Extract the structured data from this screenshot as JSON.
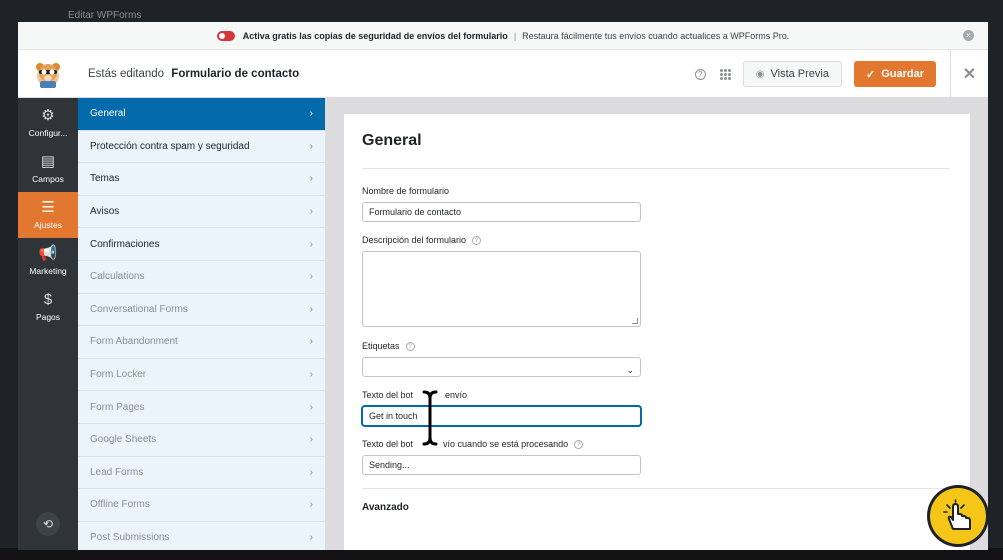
{
  "backdrop": {
    "title": "Editar WPForms"
  },
  "notice": {
    "strong_text": "Activa gratis las copias de seguridad de envíos del formulario",
    "separator": "|",
    "text": "Restaura fácilmente tus envíos cuando actualices a WPForms Pro.",
    "dismiss": "×"
  },
  "header": {
    "editing_label": "Estás editando",
    "form_name": "Formulario de contacto",
    "help": "?",
    "preview_label": "Vista Previa",
    "save_label": "Guardar",
    "close": "✕"
  },
  "panel_nav": {
    "items": [
      {
        "label": "Configur...",
        "icon": "gear-icon"
      },
      {
        "label": "Campos",
        "icon": "fields-icon"
      },
      {
        "label": "Ajustes",
        "icon": "sliders-icon"
      },
      {
        "label": "Marketing",
        "icon": "megaphone-icon"
      },
      {
        "label": "Pagos",
        "icon": "dollar-icon"
      }
    ],
    "active": "Ajustes"
  },
  "sections": {
    "items": [
      "General",
      "Protección contra spam y seguridad",
      "Temas",
      "Avisos",
      "Confirmaciones",
      "Calculations",
      "Conversational Forms",
      "Form Abandonment",
      "Form Locker",
      "Form Pages",
      "Google Sheets",
      "Lead Forms",
      "Offline Forms",
      "Post Submissions"
    ],
    "active": "General"
  },
  "content": {
    "title": "General",
    "form_name_label": "Nombre de formulario",
    "form_name_value": "Formulario de contacto",
    "description_label": "Descripción del formulario",
    "description_value": "",
    "tags_label": "Etiquetas",
    "tags_value": "",
    "submit_label": "Texto del botón de envío",
    "submit_label_visible": "Texto del bot",
    "submit_label_visible_2": "envío",
    "submit_value": "Get in touch",
    "processing_label_visible": "Texto del bot",
    "processing_label_visible_2": "vío cuando se está procesando",
    "processing_value": "Sending...",
    "advanced_heading": "Avanzado"
  }
}
